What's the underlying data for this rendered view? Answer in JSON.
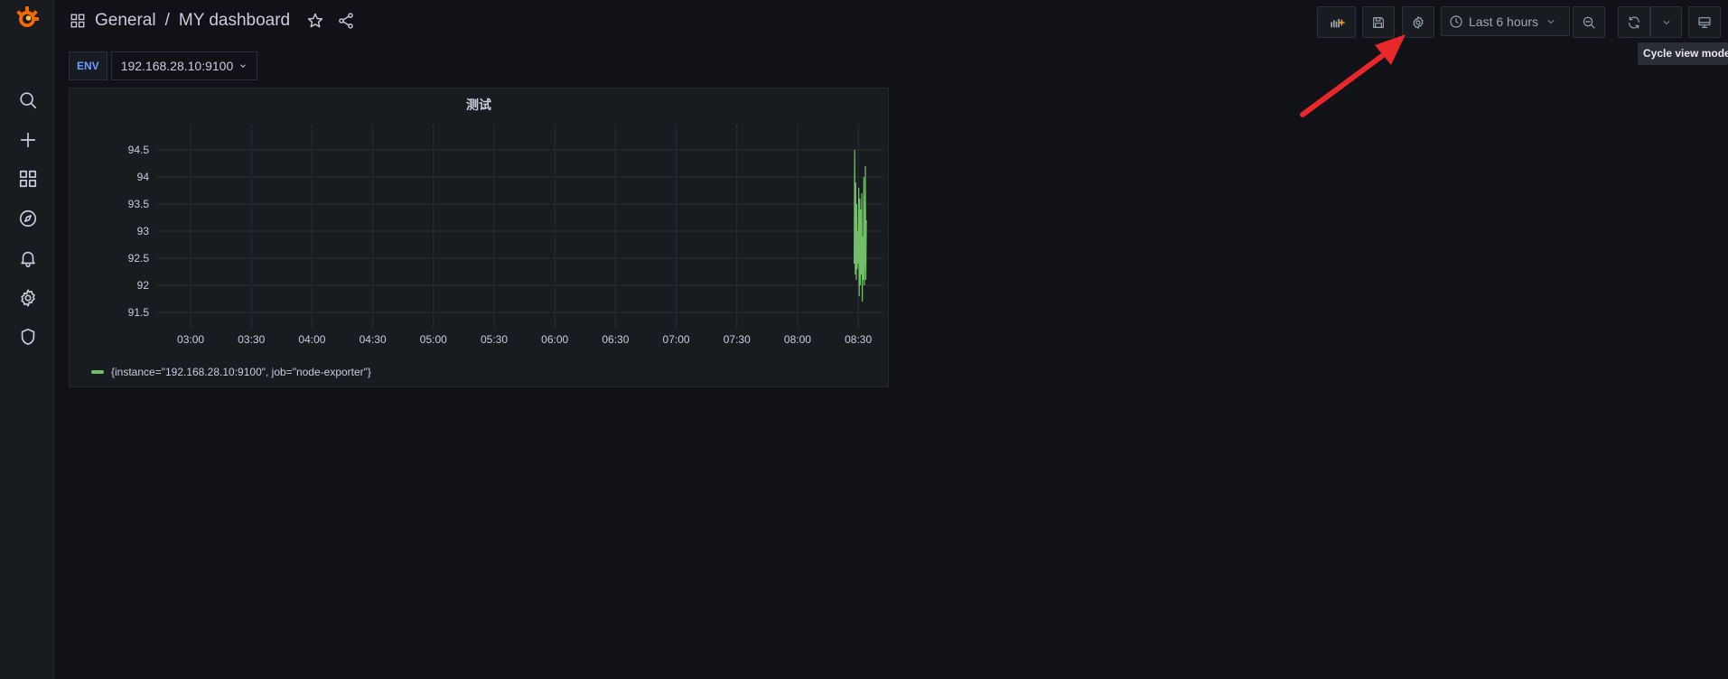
{
  "breadcrumb": {
    "folder": "General",
    "separator": "/",
    "dashboard": "MY dashboard"
  },
  "toolbar": {
    "add_panel_icon": "add-panel-icon",
    "save_icon": "save-icon",
    "settings_icon": "gear-icon",
    "time_range_label": "Last 6 hours",
    "zoom_out_icon": "zoom-out-icon",
    "refresh_icon": "refresh-icon",
    "view_mode_icon": "monitor-icon",
    "tooltip": "Cycle view mode"
  },
  "variables": {
    "label": "ENV",
    "value": "192.168.28.10:9100"
  },
  "sidebar": {
    "items": [
      {
        "icon": "search-icon"
      },
      {
        "icon": "plus-icon"
      },
      {
        "icon": "dashboards-icon"
      },
      {
        "icon": "explore-icon"
      },
      {
        "icon": "alerting-icon"
      },
      {
        "icon": "settings-icon"
      },
      {
        "icon": "shield-icon"
      }
    ]
  },
  "colors": {
    "series": "#73bf69",
    "annotation_arrow": "#e8282a",
    "logo": "#f46800"
  },
  "panel": {
    "title": "测试",
    "legend": "{instance=\"192.168.28.10:9100\", job=\"node-exporter\"}"
  },
  "chart_data": {
    "type": "line",
    "title": "测试",
    "xlabel": "",
    "ylabel": "",
    "x_ticks": [
      "03:00",
      "03:30",
      "04:00",
      "04:30",
      "05:00",
      "05:30",
      "06:00",
      "06:30",
      "07:00",
      "07:30",
      "08:00",
      "08:30"
    ],
    "y_ticks": [
      91.5,
      92,
      92.5,
      93,
      93.5,
      94,
      94.5
    ],
    "ylim": [
      91.3,
      94.8
    ],
    "xlim": [
      "02:43",
      "08:42"
    ],
    "grid": true,
    "legend_position": "bottom-left",
    "series": [
      {
        "name": "{instance=\"192.168.28.10:9100\", job=\"node-exporter\"}",
        "x": [
          "08:28",
          "08:28",
          "08:28",
          "08:29",
          "08:29",
          "08:29",
          "08:29",
          "08:30",
          "08:30",
          "08:30",
          "08:30",
          "08:31",
          "08:31",
          "08:31",
          "08:31",
          "08:32",
          "08:32",
          "08:32",
          "08:33",
          "08:33",
          "08:33",
          "08:34",
          "08:34",
          "08:34",
          "08:34"
        ],
        "values": [
          92.4,
          94.5,
          92.2,
          93.9,
          92.1,
          93.5,
          92.3,
          93.0,
          92.4,
          93.8,
          91.8,
          93.6,
          92.0,
          93.4,
          92.2,
          93.7,
          91.7,
          92.9,
          92.1,
          94.0,
          92.0,
          92.6,
          94.2,
          92.1,
          93.2
        ]
      }
    ]
  }
}
